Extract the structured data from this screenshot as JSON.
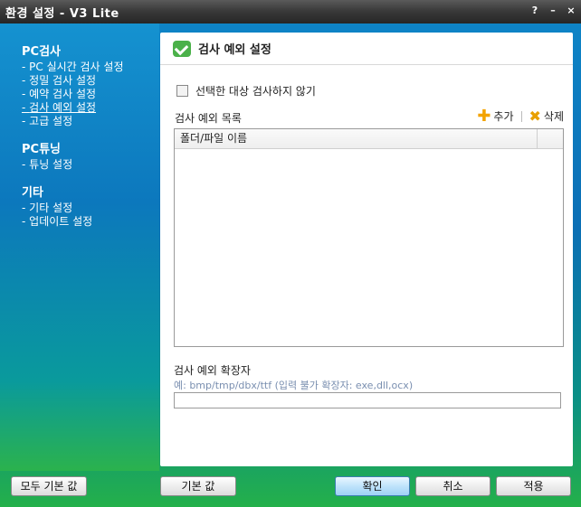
{
  "window": {
    "title": "환경 설정 - V3 Lite",
    "controls": {
      "help": "?",
      "minimize": "–",
      "close": "×"
    }
  },
  "sidebar": {
    "sections": [
      {
        "title": "PC검사",
        "items": [
          "PC 실시간 검사 설정",
          "정밀 검사 설정",
          "예약 검사 설정",
          "검사 예외 설정",
          "고급 설정"
        ]
      },
      {
        "title": "PC튜닝",
        "items": [
          "튜닝 설정"
        ]
      },
      {
        "title": "기타",
        "items": [
          "기타 설정",
          "업데이트 설정"
        ]
      }
    ],
    "active_item": "검사 예외 설정"
  },
  "panel": {
    "title": "검사 예외 설정",
    "checkbox_label": "선택한 대상 검사하지 않기",
    "checkbox_checked": false,
    "list_label": "검사 예외 목록",
    "add_label": "추가",
    "delete_label": "삭제",
    "list_columns": [
      "폴더/파일 이름",
      ""
    ],
    "list_rows": [],
    "ext_label": "검사 예외 확장자",
    "ext_hint": "예: bmp/tmp/dbx/ttf (입력 불가 확장자: exe,dll,ocx)",
    "ext_value": ""
  },
  "buttons": {
    "all_defaults": "모두 기본 값",
    "defaults": "기본 값",
    "ok": "확인",
    "cancel": "취소",
    "apply": "적용"
  },
  "colors": {
    "accent": "#0c78bd",
    "titlebar": "#3a3a3a",
    "check_icon": "#4bb14a"
  }
}
